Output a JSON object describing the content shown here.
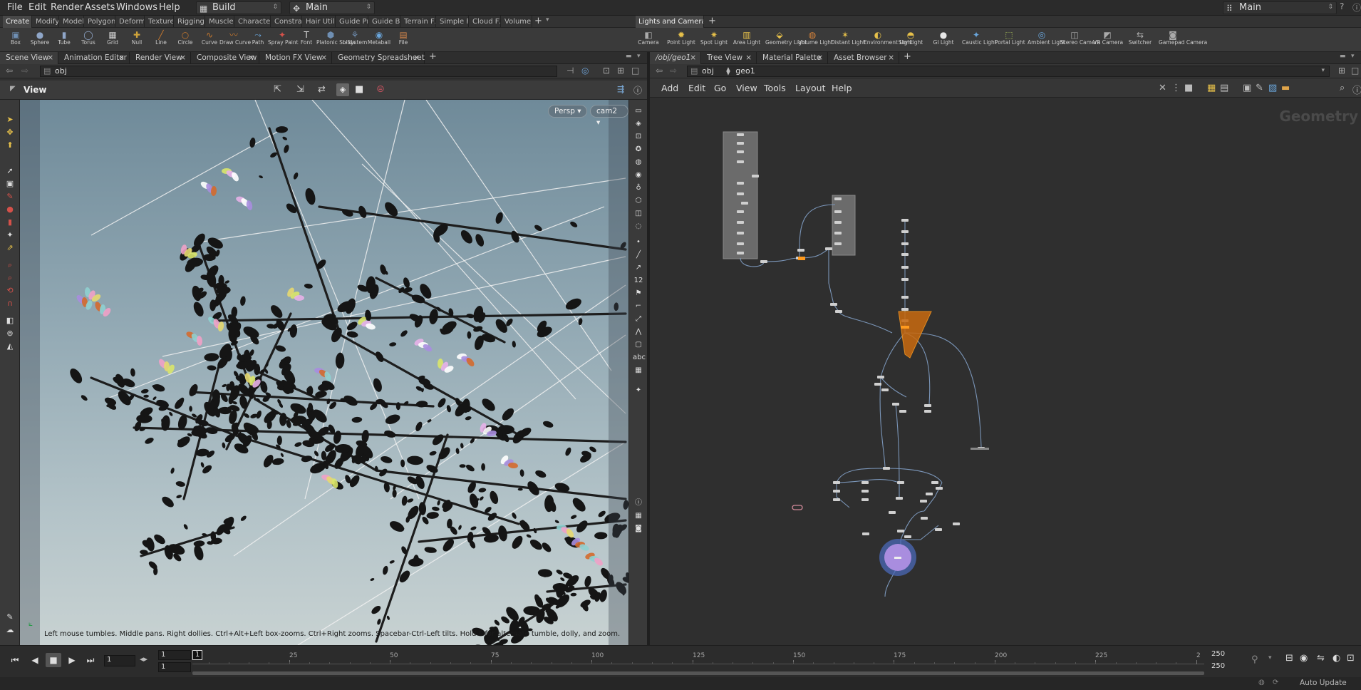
{
  "menu": {
    "items": [
      "File",
      "Edit",
      "Render",
      "Assets",
      "Windows",
      "Help"
    ],
    "desktop": "Build",
    "context": "Main",
    "desktop_right": "Main"
  },
  "shelf_tabs_left": [
    "Create",
    "Modify",
    "Model",
    "Polygon",
    "Deform",
    "Texture",
    "Rigging",
    "Muscles",
    "Characters",
    "Constrai...",
    "Hair Utils",
    "Guide Pr...",
    "Guide B...",
    "Terrain FX",
    "Simple FX",
    "Cloud FX",
    "Volume"
  ],
  "shelf_tabs_right": [
    "Lights and Cameras"
  ],
  "tools_left": [
    {
      "label": "Box",
      "icon": "box-icon"
    },
    {
      "label": "Sphere",
      "icon": "sphere-icon"
    },
    {
      "label": "Tube",
      "icon": "tube-icon"
    },
    {
      "label": "Torus",
      "icon": "torus-icon"
    },
    {
      "label": "Grid",
      "icon": "grid-icon"
    },
    {
      "label": "Null",
      "icon": "null-icon"
    },
    {
      "label": "Line",
      "icon": "line-icon"
    },
    {
      "label": "Circle",
      "icon": "circle-icon"
    },
    {
      "label": "Curve",
      "icon": "curve-icon"
    },
    {
      "label": "Draw Curve",
      "icon": "draw-curve-icon"
    },
    {
      "label": "Path",
      "icon": "path-icon"
    },
    {
      "label": "Spray Paint",
      "icon": "spray-paint-icon"
    },
    {
      "label": "Font",
      "icon": "font-icon"
    },
    {
      "label": "Platonic Solids",
      "icon": "platonic-icon"
    },
    {
      "label": "L-System",
      "icon": "lsystem-icon"
    },
    {
      "label": "Metaball",
      "icon": "metaball-icon"
    },
    {
      "label": "File",
      "icon": "file-icon"
    }
  ],
  "tools_right": [
    {
      "label": "Camera",
      "icon": "camera-icon"
    },
    {
      "label": "Point Light",
      "icon": "point-light-icon"
    },
    {
      "label": "Spot Light",
      "icon": "spot-light-icon"
    },
    {
      "label": "Area Light",
      "icon": "area-light-icon"
    },
    {
      "label": "Geometry Light",
      "icon": "geometry-light-icon"
    },
    {
      "label": "Volume Light",
      "icon": "volume-light-icon"
    },
    {
      "label": "Distant Light",
      "icon": "distant-light-icon"
    },
    {
      "label": "Environment Light",
      "icon": "environment-light-icon"
    },
    {
      "label": "Sky Light",
      "icon": "sky-light-icon"
    },
    {
      "label": "GI Light",
      "icon": "gi-light-icon"
    },
    {
      "label": "Caustic Light",
      "icon": "caustic-light-icon"
    },
    {
      "label": "Portal Light",
      "icon": "portal-light-icon"
    },
    {
      "label": "Ambient Light",
      "icon": "ambient-light-icon"
    },
    {
      "label": "Stereo Camera",
      "icon": "stereo-camera-icon"
    },
    {
      "label": "VR Camera",
      "icon": "vr-camera-icon"
    },
    {
      "label": "Switcher",
      "icon": "switcher-icon"
    },
    {
      "label": "Gamepad Camera",
      "icon": "gamepad-camera-icon"
    }
  ],
  "pane_tabs_left": [
    "Scene View",
    "Animation Editor",
    "Render View",
    "Composite View",
    "Motion FX View",
    "Geometry Spreadsheet"
  ],
  "pane_tabs_right": [
    "/obj/geo1",
    "Tree View",
    "Material Palette",
    "Asset Browser"
  ],
  "left_path": "obj",
  "right_path": [
    "obj",
    "geo1"
  ],
  "viewer": {
    "title": "View",
    "persp": "Persp",
    "camera": "cam2",
    "hint": "Left mouse tumbles. Middle pans. Right dollies. Ctrl+Alt+Left box-zooms. Ctrl+Right zooms. Spacebar-Ctrl-Left tilts. Hold L for alternate tumble, dolly, and zoom."
  },
  "network_menu": [
    "Add",
    "Edit",
    "Go",
    "View",
    "Tools",
    "Layout",
    "Help"
  ],
  "network_label": "Geometry",
  "timeline": {
    "frame": "1",
    "start1": "1",
    "start2": "1",
    "end1": "250",
    "end2": "250",
    "current": "1",
    "ticks": [
      "25",
      "50",
      "75",
      "100",
      "125",
      "150",
      "175",
      "200",
      "225",
      "2"
    ]
  },
  "status": {
    "auto_update": "Auto Update"
  },
  "colors": {
    "accent": "#ff9a1e",
    "node_selected": "#a98ddf",
    "bg": "#2f2f2f"
  }
}
